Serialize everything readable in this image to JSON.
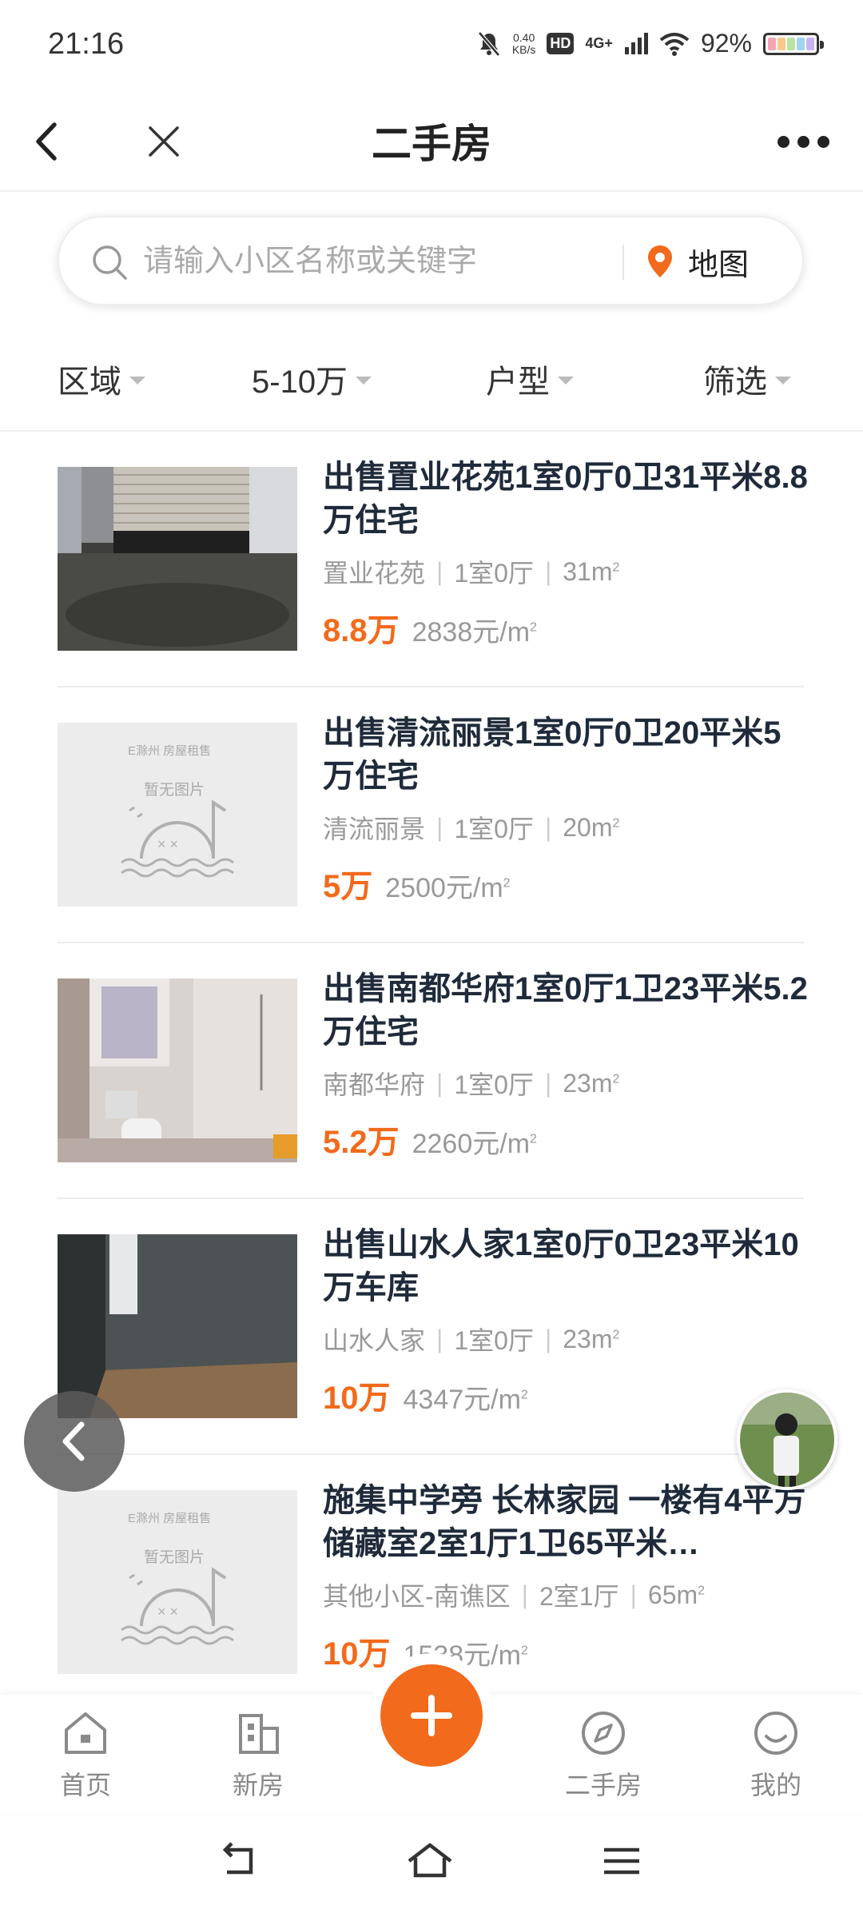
{
  "status_bar": {
    "time": "21:16",
    "net_speed_value": "0.40",
    "net_speed_unit": "KB/s",
    "hd": "HD",
    "network": "4G+",
    "battery": "92%"
  },
  "header": {
    "title": "二手房"
  },
  "search": {
    "placeholder": "请输入小区名称或关键字",
    "map_label": "地图"
  },
  "filters": [
    {
      "label": "区域"
    },
    {
      "label": "5-10万"
    },
    {
      "label": "户型"
    },
    {
      "label": "筛选"
    }
  ],
  "listings": [
    {
      "title": "出售置业花苑1室0厅0卫31平米8.8万住宅",
      "community": "置业花苑",
      "layout": "1室0厅",
      "area": "31m",
      "total": "8.8万",
      "unit_price": "2838元/m"
    },
    {
      "title": "出售清流丽景1室0厅0卫20平米5万住宅",
      "community": "清流丽景",
      "layout": "1室0厅",
      "area": "20m",
      "total": "5万",
      "unit_price": "2500元/m",
      "no_image": "暂无图片",
      "brand": "E滁州 房屋租售"
    },
    {
      "title": "出售南都华府1室0厅1卫23平米5.2万住宅",
      "community": "南都华府",
      "layout": "1室0厅",
      "area": "23m",
      "total": "5.2万",
      "unit_price": "2260元/m"
    },
    {
      "title": "出售山水人家1室0厅0卫23平米10万车库",
      "community": "山水人家",
      "layout": "1室0厅",
      "area": "23m",
      "total": "10万",
      "unit_price": "4347元/m"
    },
    {
      "title": "施集中学旁 长林家园 一楼有4平方储藏室2室1厅1卫65平米…",
      "community": "其他小区-南谯区",
      "layout": "2室1厅",
      "area": "65m",
      "total": "10万",
      "unit_price": "1538元/m",
      "no_image": "暂无图片",
      "brand": "E滁州 房屋租售"
    }
  ],
  "area_superscript": "2",
  "tabs": [
    {
      "label": "首页"
    },
    {
      "label": "新房"
    },
    {
      "label": "二手房"
    },
    {
      "label": "我的"
    }
  ],
  "colors": {
    "accent": "#f26a1b",
    "title": "#1f2a3a",
    "muted": "#999999"
  }
}
